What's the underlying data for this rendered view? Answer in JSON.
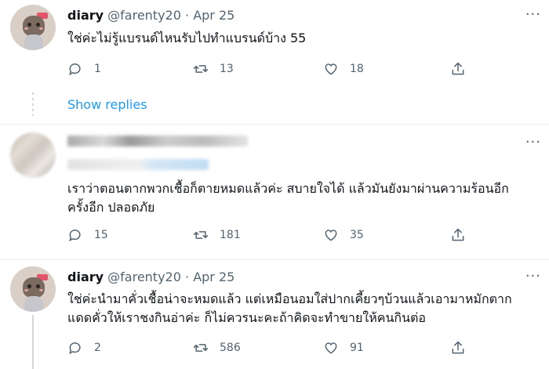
{
  "tweets": [
    {
      "name": "diary",
      "handle": "@farenty20",
      "sep": "·",
      "date": "Apr 25",
      "text": "ใช่ค่ะไม่รู้แบรนด์ไหนรับไปทำแบรนด์บ้าง 55",
      "replies": "1",
      "retweets": "13",
      "likes": "18"
    },
    {
      "text_line1": "เราว่าตอนตากพวกเชื้อก็ตายหมดแล้วค่ะ สบายใจได้ แล้วมันยังมาผ่านความร้อนอีก",
      "text_line2": "ครั้งอีก ปลอดภัย",
      "replies": "15",
      "retweets": "181",
      "likes": "35"
    },
    {
      "name": "diary",
      "handle": "@farenty20",
      "sep": "·",
      "date": "Apr 25",
      "text_line1": "ใช่ค่ะนำมาคั่วเชื้อน่าจะหมดแล้ว แต่เหมือนอมใส่ปากเคี้ยวๆบ้วนแล้วเอามาหมักตาก",
      "text_line2": "แดดคั่วให้เราชงกินอ่าค่ะ ก็ไม่ควรนะคะถ้าคิดจะทำขายให้คนกินต่อ",
      "replies": "2",
      "retweets": "586",
      "likes": "91"
    }
  ],
  "show_replies": "Show replies",
  "more_glyph": "···"
}
